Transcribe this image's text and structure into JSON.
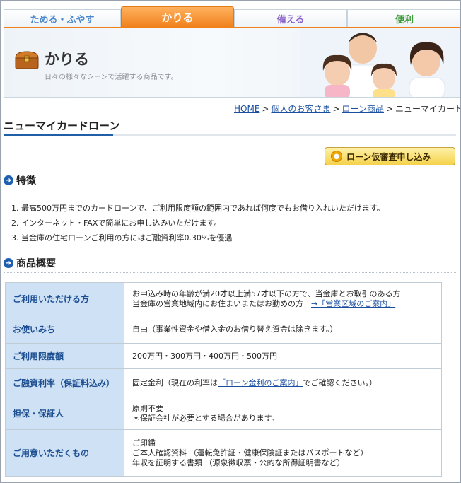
{
  "tabs": [
    {
      "label": "ためる・ふやす"
    },
    {
      "label": "かりる"
    },
    {
      "label": "備える"
    },
    {
      "label": "便利"
    }
  ],
  "banner": {
    "title": "かりる",
    "subtitle": "日々の様々なシーンで活躍する商品です。"
  },
  "breadcrumb": {
    "items": [
      "HOME",
      "個人のお客さま",
      "ローン商品"
    ],
    "current": "ニューマイカードローン",
    "separator": ">"
  },
  "page_title": "ニューマイカードローン",
  "apply_button": {
    "label": "ローン仮審査申し込み"
  },
  "features": {
    "heading": "特徴",
    "items": [
      "1. 最高500万円までのカードローンで、ご利用限度額の範囲内であれば何度でもお借り入れいただけます。",
      "2. インターネット・FAXで簡単にお申し込みいただけます。",
      "3. 当金庫の住宅ローンご利用の方にはご融資利率0.30%を優遇"
    ]
  },
  "overview": {
    "heading": "商品概要",
    "rows": [
      {
        "label": "ご利用いただける方",
        "lines": [
          "お申込み時の年齢が満20才以上満57才以下の方で、当金庫とお取引のある方",
          "当金庫の営業地域内にお住まいまたはお勤めの方"
        ],
        "link": "→「営業区域のご案内」"
      },
      {
        "label": "お使いみち",
        "lines": [
          "自由（事業性資金や借入金のお借り替え資金は除きます。）"
        ]
      },
      {
        "label": "ご利用限度額",
        "lines": [
          "200万円・300万円・400万円・500万円"
        ]
      },
      {
        "label": "ご融資利率（保証料込み）",
        "pre": "固定金利（現在の利率は",
        "link": "「ローン金利のご案内」",
        "post": "でご確認ください。）"
      },
      {
        "label": "担保・保証人",
        "lines": [
          "原則不要",
          "＊保証会社が必要とする場合があります。"
        ]
      },
      {
        "label": "ご用意いただくもの",
        "lines": [
          "ご印鑑",
          "ご本人確認資料 （運転免許証・健康保険証またはパスポートなど）",
          "年収を証明する書類 （源泉徴収票・公的な所得証明書など）"
        ]
      }
    ]
  },
  "colors": {
    "accent_orange": "#f0801a",
    "link_blue": "#1a4fa0",
    "table_header_bg": "#cfe2f5"
  }
}
